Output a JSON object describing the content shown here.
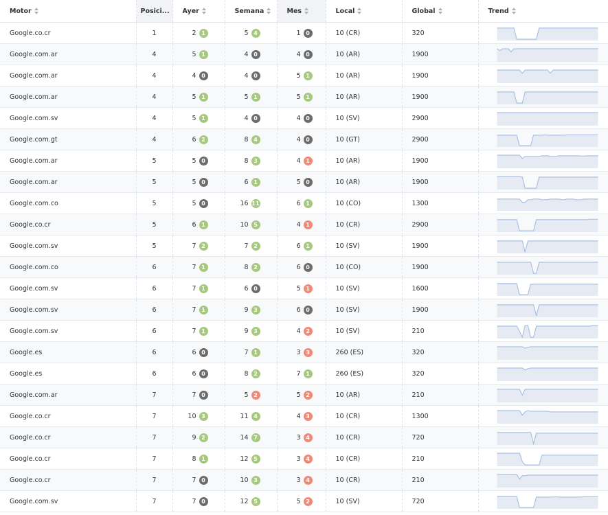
{
  "columns": [
    "Motor",
    "Posici...",
    "Ayer",
    "Semana",
    "Mes",
    "Local",
    "Global",
    "Trend"
  ],
  "colors": {
    "up": "#a6c87f",
    "zero": "#6c6c6c",
    "down": "#ef8a78",
    "trend_line": "#a9c1e3",
    "trend_fill": "#e6ebf3"
  },
  "rows": [
    {
      "motor": "Google.co.cr",
      "pos": "1",
      "ayer": "2",
      "ayer_b": "1",
      "ayer_s": "up",
      "semana": "5",
      "semana_b": "4",
      "semana_s": "up",
      "mes": "1",
      "mes_b": "0",
      "mes_s": "zero",
      "local": "10 (CR)",
      "global": "320",
      "trend": [
        0.9,
        0.9,
        0.9,
        0.9,
        0.9,
        0.9,
        0.9,
        0.05,
        0.05,
        0.05,
        0.05,
        0.05,
        0.05,
        0.05,
        0.05,
        0.9,
        0.9,
        0.9,
        0.9,
        0.9,
        0.9,
        0.9,
        0.9,
        0.9,
        0.9,
        0.9,
        0.9,
        0.9,
        0.9,
        0.9,
        0.9,
        0.9,
        0.9,
        0.9,
        0.9,
        0.9,
        0.9
      ]
    },
    {
      "motor": "Google.com.ar",
      "pos": "4",
      "ayer": "5",
      "ayer_b": "1",
      "ayer_s": "up",
      "semana": "4",
      "semana_b": "0",
      "semana_s": "zero",
      "mes": "4",
      "mes_b": "0",
      "mes_s": "zero",
      "local": "10 (AR)",
      "global": "1900",
      "trend": [
        0.95,
        0.8,
        0.95,
        0.95,
        0.95,
        0.7,
        0.95,
        0.95,
        0.95,
        0.95,
        0.95,
        0.95,
        0.95,
        0.95,
        0.95,
        0.95,
        0.95,
        0.95,
        0.95,
        0.95,
        0.95,
        0.95,
        0.95,
        0.95,
        0.95,
        0.95,
        0.95,
        0.95,
        0.95,
        0.95,
        0.95,
        0.95,
        0.95,
        0.95,
        0.95,
        0.95,
        0.95
      ]
    },
    {
      "motor": "Google.com.ar",
      "pos": "4",
      "ayer": "4",
      "ayer_b": "0",
      "ayer_s": "zero",
      "semana": "4",
      "semana_b": "0",
      "semana_s": "zero",
      "mes": "5",
      "mes_b": "1",
      "mes_s": "up",
      "local": "10 (AR)",
      "global": "1900",
      "trend": [
        0.95,
        0.95,
        0.95,
        0.95,
        0.95,
        0.95,
        0.95,
        0.95,
        0.95,
        0.7,
        0.95,
        0.95,
        0.95,
        0.95,
        0.95,
        0.95,
        0.95,
        0.95,
        0.95,
        0.7,
        0.95,
        0.95,
        0.95,
        0.95,
        0.95,
        0.95,
        0.95,
        0.95,
        0.95,
        0.95,
        0.95,
        0.95,
        0.95,
        0.95,
        0.95,
        0.95,
        0.95
      ]
    },
    {
      "motor": "Google.com.ar",
      "pos": "4",
      "ayer": "5",
      "ayer_b": "1",
      "ayer_s": "up",
      "semana": "5",
      "semana_b": "1",
      "semana_s": "up",
      "mes": "5",
      "mes_b": "1",
      "mes_s": "up",
      "local": "10 (AR)",
      "global": "1900",
      "trend": [
        0.9,
        0.9,
        0.9,
        0.9,
        0.9,
        0.9,
        0.9,
        0.05,
        0.05,
        0.05,
        0.9,
        0.9,
        0.9,
        0.9,
        0.9,
        0.9,
        0.9,
        0.9,
        0.9,
        0.9,
        0.9,
        0.9,
        0.9,
        0.9,
        0.9,
        0.9,
        0.9,
        0.9,
        0.9,
        0.9,
        0.9,
        0.9,
        0.9,
        0.9,
        0.9,
        0.9,
        0.9
      ]
    },
    {
      "motor": "Google.com.sv",
      "pos": "4",
      "ayer": "5",
      "ayer_b": "1",
      "ayer_s": "up",
      "semana": "4",
      "semana_b": "0",
      "semana_s": "zero",
      "mes": "4",
      "mes_b": "0",
      "mes_s": "zero",
      "local": "10 (SV)",
      "global": "2900",
      "trend": [
        0.95,
        0.95,
        0.95,
        0.95,
        0.95,
        0.95,
        0.95,
        0.95,
        0.95,
        0.95,
        0.95,
        0.95,
        0.95,
        0.95,
        0.95,
        0.95,
        0.95,
        0.95,
        0.95,
        0.95,
        0.95,
        0.95,
        0.95,
        0.95,
        0.95,
        0.95,
        0.95,
        0.95,
        0.95,
        0.95,
        0.95,
        0.95,
        0.95,
        0.95,
        0.95,
        0.95,
        0.95
      ]
    },
    {
      "motor": "Google.com.gt",
      "pos": "4",
      "ayer": "6",
      "ayer_b": "2",
      "ayer_s": "up",
      "semana": "8",
      "semana_b": "4",
      "semana_s": "up",
      "mes": "4",
      "mes_b": "0",
      "mes_s": "zero",
      "local": "10 (GT)",
      "global": "2900",
      "trend": [
        0.85,
        0.85,
        0.85,
        0.85,
        0.85,
        0.85,
        0.85,
        0.85,
        0.05,
        0.05,
        0.05,
        0.05,
        0.05,
        0.85,
        0.85,
        0.85,
        0.85,
        0.88,
        0.85,
        0.85,
        0.85,
        0.85,
        0.85,
        0.85,
        0.85,
        0.88,
        0.88,
        0.88,
        0.88,
        0.88,
        0.88,
        0.88,
        0.88,
        0.88,
        0.88,
        0.88,
        0.88
      ]
    },
    {
      "motor": "Google.com.ar",
      "pos": "5",
      "ayer": "5",
      "ayer_b": "0",
      "ayer_s": "zero",
      "semana": "8",
      "semana_b": "3",
      "semana_s": "up",
      "mes": "4",
      "mes_b": "1",
      "mes_s": "down",
      "local": "10 (AR)",
      "global": "1900",
      "trend": [
        0.95,
        0.95,
        0.95,
        0.95,
        0.95,
        0.95,
        0.95,
        0.95,
        0.95,
        0.7,
        0.85,
        0.85,
        0.85,
        0.85,
        0.85,
        0.85,
        0.9,
        0.9,
        0.9,
        0.85,
        0.85,
        0.85,
        0.9,
        0.9,
        0.9,
        0.9,
        0.9,
        0.9,
        0.9,
        0.9,
        0.88,
        0.88,
        0.9,
        0.9,
        0.9,
        0.9,
        0.9
      ]
    },
    {
      "motor": "Google.com.ar",
      "pos": "5",
      "ayer": "5",
      "ayer_b": "0",
      "ayer_s": "zero",
      "semana": "6",
      "semana_b": "1",
      "semana_s": "up",
      "mes": "5",
      "mes_b": "0",
      "mes_s": "zero",
      "local": "10 (AR)",
      "global": "1900",
      "trend": [
        0.95,
        0.95,
        0.95,
        0.95,
        0.95,
        0.95,
        0.95,
        0.95,
        0.95,
        0.9,
        0.05,
        0.05,
        0.05,
        0.05,
        0.05,
        0.9,
        0.9,
        0.9,
        0.9,
        0.9,
        0.9,
        0.9,
        0.9,
        0.9,
        0.9,
        0.9,
        0.9,
        0.9,
        0.9,
        0.9,
        0.9,
        0.9,
        0.9,
        0.9,
        0.9,
        0.9,
        0.9
      ]
    },
    {
      "motor": "Google.com.co",
      "pos": "5",
      "ayer": "5",
      "ayer_b": "0",
      "ayer_s": "zero",
      "semana": "16",
      "semana_b": "11",
      "semana_s": "up",
      "mes": "6",
      "mes_b": "1",
      "mes_s": "up",
      "local": "10 (CO)",
      "global": "1300",
      "trend": [
        0.85,
        0.85,
        0.85,
        0.85,
        0.85,
        0.85,
        0.85,
        0.85,
        0.85,
        0.6,
        0.6,
        0.8,
        0.8,
        0.85,
        0.85,
        0.85,
        0.8,
        0.8,
        0.8,
        0.85,
        0.85,
        0.85,
        0.85,
        0.8,
        0.8,
        0.85,
        0.85,
        0.85,
        0.8,
        0.8,
        0.8,
        0.85,
        0.85,
        0.85,
        0.85,
        0.85,
        0.85
      ]
    },
    {
      "motor": "Google.co.cr",
      "pos": "5",
      "ayer": "6",
      "ayer_b": "1",
      "ayer_s": "up",
      "semana": "10",
      "semana_b": "5",
      "semana_s": "up",
      "mes": "4",
      "mes_b": "1",
      "mes_s": "down",
      "local": "10 (CR)",
      "global": "2900",
      "trend": [
        0.9,
        0.9,
        0.9,
        0.9,
        0.9,
        0.9,
        0.9,
        0.9,
        0.05,
        0.05,
        0.05,
        0.05,
        0.05,
        0.05,
        0.9,
        0.9,
        0.9,
        0.9,
        0.9,
        0.9,
        0.9,
        0.9,
        0.9,
        0.9,
        0.9,
        0.9,
        0.9,
        0.9,
        0.9,
        0.9,
        0.9,
        0.9,
        0.9,
        0.93,
        0.93,
        0.93,
        0.93
      ]
    },
    {
      "motor": "Google.com.sv",
      "pos": "5",
      "ayer": "7",
      "ayer_b": "2",
      "ayer_s": "up",
      "semana": "7",
      "semana_b": "2",
      "semana_s": "up",
      "mes": "6",
      "mes_b": "1",
      "mes_s": "up",
      "local": "10 (SV)",
      "global": "1900",
      "trend": [
        0.9,
        0.9,
        0.9,
        0.9,
        0.9,
        0.9,
        0.9,
        0.9,
        0.9,
        0.9,
        0.05,
        0.9,
        0.9,
        0.9,
        0.9,
        0.9,
        0.9,
        0.9,
        0.9,
        0.9,
        0.9,
        0.9,
        0.9,
        0.9,
        0.9,
        0.9,
        0.9,
        0.9,
        0.9,
        0.9,
        0.9,
        0.9,
        0.9,
        0.9,
        0.9,
        0.9,
        0.9
      ]
    },
    {
      "motor": "Google.com.co",
      "pos": "6",
      "ayer": "7",
      "ayer_b": "1",
      "ayer_s": "up",
      "semana": "8",
      "semana_b": "2",
      "semana_s": "up",
      "mes": "6",
      "mes_b": "0",
      "mes_s": "zero",
      "local": "10 (CO)",
      "global": "1900",
      "trend": [
        0.9,
        0.9,
        0.9,
        0.9,
        0.9,
        0.9,
        0.9,
        0.9,
        0.9,
        0.9,
        0.9,
        0.9,
        0.9,
        0.05,
        0.05,
        0.9,
        0.9,
        0.9,
        0.9,
        0.9,
        0.9,
        0.9,
        0.9,
        0.9,
        0.9,
        0.9,
        0.9,
        0.9,
        0.9,
        0.9,
        0.9,
        0.9,
        0.9,
        0.9,
        0.9,
        0.9,
        0.9
      ]
    },
    {
      "motor": "Google.com.sv",
      "pos": "6",
      "ayer": "7",
      "ayer_b": "1",
      "ayer_s": "up",
      "semana": "6",
      "semana_b": "0",
      "semana_s": "zero",
      "mes": "5",
      "mes_b": "1",
      "mes_s": "down",
      "local": "10 (SV)",
      "global": "1600",
      "trend": [
        0.9,
        0.9,
        0.9,
        0.9,
        0.9,
        0.9,
        0.9,
        0.9,
        0.05,
        0.05,
        0.05,
        0.05,
        0.85,
        0.85,
        0.85,
        0.85,
        0.85,
        0.85,
        0.85,
        0.85,
        0.85,
        0.85,
        0.85,
        0.85,
        0.85,
        0.85,
        0.85,
        0.85,
        0.85,
        0.85,
        0.85,
        0.85,
        0.85,
        0.85,
        0.85,
        0.85,
        0.85
      ]
    },
    {
      "motor": "Google.com.sv",
      "pos": "6",
      "ayer": "7",
      "ayer_b": "1",
      "ayer_s": "up",
      "semana": "9",
      "semana_b": "3",
      "semana_s": "up",
      "mes": "6",
      "mes_b": "0",
      "mes_s": "zero",
      "local": "10 (SV)",
      "global": "1900",
      "trend": [
        0.9,
        0.9,
        0.9,
        0.9,
        0.9,
        0.9,
        0.9,
        0.9,
        0.9,
        0.9,
        0.9,
        0.9,
        0.9,
        0.9,
        0.05,
        0.9,
        0.9,
        0.9,
        0.9,
        0.9,
        0.9,
        0.9,
        0.9,
        0.9,
        0.9,
        0.9,
        0.9,
        0.9,
        0.9,
        0.9,
        0.9,
        0.9,
        0.9,
        0.9,
        0.9,
        0.9,
        0.9
      ]
    },
    {
      "motor": "Google.com.sv",
      "pos": "6",
      "ayer": "7",
      "ayer_b": "1",
      "ayer_s": "up",
      "semana": "9",
      "semana_b": "3",
      "semana_s": "up",
      "mes": "4",
      "mes_b": "2",
      "mes_s": "down",
      "local": "10 (SV)",
      "global": "210",
      "trend": [
        0.9,
        0.9,
        0.9,
        0.9,
        0.9,
        0.9,
        0.9,
        0.9,
        0.5,
        0.05,
        0.95,
        0.95,
        0.05,
        0.05,
        0.9,
        0.9,
        0.9,
        0.9,
        0.9,
        0.9,
        0.9,
        0.9,
        0.9,
        0.9,
        0.9,
        0.9,
        0.9,
        0.9,
        0.9,
        0.9,
        0.9,
        0.9,
        0.9,
        0.9,
        0.95,
        0.95,
        0.95
      ]
    },
    {
      "motor": "Google.es",
      "pos": "6",
      "ayer": "6",
      "ayer_b": "0",
      "ayer_s": "zero",
      "semana": "7",
      "semana_b": "1",
      "semana_s": "up",
      "mes": "3",
      "mes_b": "3",
      "mes_s": "down",
      "local": "260 (ES)",
      "global": "320",
      "trend": [
        0.95,
        0.95,
        0.95,
        0.95,
        0.95,
        0.95,
        0.95,
        0.95,
        0.95,
        0.95,
        0.85,
        0.9,
        0.95,
        0.95,
        0.95,
        0.95,
        0.95,
        0.95,
        0.95,
        0.95,
        0.95,
        0.95,
        0.95,
        0.95,
        0.95,
        0.95,
        0.95,
        0.95,
        0.95,
        0.95,
        0.95,
        0.95,
        0.95,
        0.95,
        0.95,
        0.95,
        0.95
      ]
    },
    {
      "motor": "Google.es",
      "pos": "6",
      "ayer": "6",
      "ayer_b": "0",
      "ayer_s": "zero",
      "semana": "8",
      "semana_b": "2",
      "semana_s": "up",
      "mes": "7",
      "mes_b": "1",
      "mes_s": "up",
      "local": "260 (ES)",
      "global": "320",
      "trend": [
        0.95,
        0.95,
        0.95,
        0.95,
        0.95,
        0.95,
        0.95,
        0.95,
        0.95,
        0.95,
        0.8,
        0.9,
        0.95,
        0.95,
        0.95,
        0.95,
        0.95,
        0.95,
        0.95,
        0.95,
        0.95,
        0.95,
        0.95,
        0.95,
        0.95,
        0.95,
        0.95,
        0.95,
        0.95,
        0.95,
        0.95,
        0.95,
        0.95,
        0.95,
        0.95,
        0.95,
        0.95
      ]
    },
    {
      "motor": "Google.com.ar",
      "pos": "7",
      "ayer": "7",
      "ayer_b": "0",
      "ayer_s": "zero",
      "semana": "5",
      "semana_b": "2",
      "semana_s": "down",
      "mes": "5",
      "mes_b": "2",
      "mes_s": "down",
      "local": "10 (AR)",
      "global": "210",
      "trend": [
        0.95,
        0.95,
        0.95,
        0.95,
        0.95,
        0.95,
        0.95,
        0.95,
        0.95,
        0.5,
        0.95,
        0.95,
        0.95,
        0.95,
        0.95,
        0.95,
        0.95,
        0.95,
        0.95,
        0.95,
        0.95,
        0.95,
        0.95,
        0.95,
        0.95,
        0.95,
        0.95,
        0.95,
        0.95,
        0.95,
        0.95,
        0.95,
        0.95,
        0.95,
        0.95,
        0.95,
        0.95
      ]
    },
    {
      "motor": "Google.co.cr",
      "pos": "7",
      "ayer": "10",
      "ayer_b": "3",
      "ayer_s": "up",
      "semana": "11",
      "semana_b": "4",
      "semana_s": "up",
      "mes": "4",
      "mes_b": "3",
      "mes_s": "down",
      "local": "10 (CR)",
      "global": "1300",
      "trend": [
        0.95,
        0.95,
        0.95,
        0.95,
        0.95,
        0.95,
        0.95,
        0.95,
        0.95,
        0.6,
        0.85,
        0.95,
        0.9,
        0.9,
        0.9,
        0.9,
        0.9,
        0.9,
        0.9,
        0.85,
        0.85,
        0.85,
        0.85,
        0.85,
        0.85,
        0.85,
        0.85,
        0.85,
        0.85,
        0.85,
        0.85,
        0.85,
        0.85,
        0.85,
        0.85,
        0.85,
        0.85
      ]
    },
    {
      "motor": "Google.co.cr",
      "pos": "7",
      "ayer": "9",
      "ayer_b": "2",
      "ayer_s": "up",
      "semana": "14",
      "semana_b": "7",
      "semana_s": "up",
      "mes": "3",
      "mes_b": "4",
      "mes_s": "down",
      "local": "10 (CR)",
      "global": "720",
      "trend": [
        0.9,
        0.9,
        0.9,
        0.9,
        0.9,
        0.9,
        0.9,
        0.9,
        0.9,
        0.9,
        0.9,
        0.9,
        0.9,
        0.05,
        0.85,
        0.85,
        0.85,
        0.85,
        0.85,
        0.85,
        0.85,
        0.85,
        0.85,
        0.85,
        0.85,
        0.85,
        0.85,
        0.85,
        0.85,
        0.85,
        0.85,
        0.85,
        0.85,
        0.85,
        0.85,
        0.85,
        0.85
      ]
    },
    {
      "motor": "Google.co.cr",
      "pos": "7",
      "ayer": "8",
      "ayer_b": "1",
      "ayer_s": "up",
      "semana": "12",
      "semana_b": "5",
      "semana_s": "up",
      "mes": "3",
      "mes_b": "4",
      "mes_s": "down",
      "local": "10 (CR)",
      "global": "210",
      "trend": [
        0.95,
        0.95,
        0.95,
        0.95,
        0.95,
        0.95,
        0.95,
        0.95,
        0.95,
        0.3,
        0.05,
        0.05,
        0.05,
        0.05,
        0.05,
        0.05,
        0.8,
        0.8,
        0.8,
        0.8,
        0.8,
        0.8,
        0.8,
        0.8,
        0.8,
        0.8,
        0.8,
        0.8,
        0.8,
        0.8,
        0.8,
        0.8,
        0.8,
        0.8,
        0.8,
        0.8,
        0.8
      ]
    },
    {
      "motor": "Google.co.cr",
      "pos": "7",
      "ayer": "7",
      "ayer_b": "0",
      "ayer_s": "zero",
      "semana": "10",
      "semana_b": "3",
      "semana_s": "up",
      "mes": "3",
      "mes_b": "4",
      "mes_s": "down",
      "local": "10 (CR)",
      "global": "210",
      "trend": [
        0.95,
        0.95,
        0.95,
        0.95,
        0.95,
        0.95,
        0.95,
        0.95,
        0.6,
        0.85,
        0.85,
        0.9,
        0.9,
        0.9,
        0.9,
        0.9,
        0.9,
        0.9,
        0.9,
        0.9,
        0.9,
        0.9,
        0.9,
        0.9,
        0.9,
        0.9,
        0.9,
        0.9,
        0.9,
        0.9,
        0.9,
        0.9,
        0.9,
        0.9,
        0.9,
        0.9,
        0.9
      ]
    },
    {
      "motor": "Google.com.sv",
      "pos": "7",
      "ayer": "7",
      "ayer_b": "0",
      "ayer_s": "zero",
      "semana": "12",
      "semana_b": "5",
      "semana_s": "up",
      "mes": "5",
      "mes_b": "2",
      "mes_s": "down",
      "local": "10 (SV)",
      "global": "720",
      "trend": [
        0.9,
        0.9,
        0.9,
        0.9,
        0.9,
        0.9,
        0.9,
        0.9,
        0.05,
        0.05,
        0.05,
        0.05,
        0.05,
        0.05,
        0.85,
        0.85,
        0.85,
        0.85,
        0.85,
        0.85,
        0.85,
        0.88,
        0.85,
        0.85,
        0.85,
        0.85,
        0.85,
        0.85,
        0.85,
        0.85,
        0.85,
        0.88,
        0.88,
        0.88,
        0.88,
        0.88,
        0.88
      ]
    }
  ]
}
